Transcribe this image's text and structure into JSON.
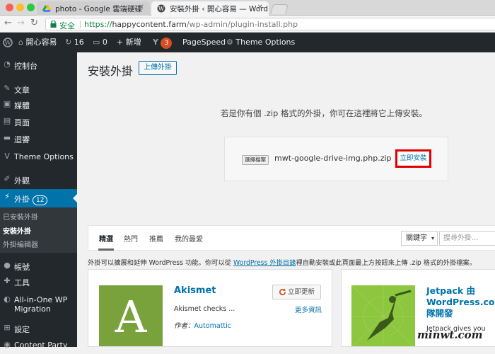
{
  "browser": {
    "tabs": [
      {
        "title": "photo - Google 雲端硬碟",
        "active": false
      },
      {
        "title": "安裝外掛 ‹ 開心容易 — WordPr",
        "active": true
      }
    ],
    "secure_label": "安全",
    "url_scheme": "https://",
    "url_host": "happycontent.farm",
    "url_path": "/wp-admin/plugin-install.php"
  },
  "adminbar": {
    "site_name": "開心容易",
    "updates_count": "16",
    "comments_count": "0",
    "new_label": "+ 新增",
    "yoast_count": "3",
    "pagespeed_label": "PageSpeed",
    "theme_options_label": "Theme Options"
  },
  "sidebar": {
    "items": [
      {
        "label": "控制台",
        "icon": "dashboard-icon"
      },
      {
        "label": "文章",
        "icon": "pin-icon"
      },
      {
        "label": "媒體",
        "icon": "media-icon"
      },
      {
        "label": "頁面",
        "icon": "page-icon"
      },
      {
        "label": "迴響",
        "icon": "comment-icon"
      },
      {
        "label": "Theme Options",
        "icon": "theme-options-icon"
      },
      {
        "label": "外觀",
        "icon": "appearance-icon"
      },
      {
        "label": "外掛",
        "icon": "plugin-icon",
        "count": "12"
      },
      {
        "label": "帳號",
        "icon": "user-icon"
      },
      {
        "label": "工具",
        "icon": "tools-icon"
      },
      {
        "label": "All-in-One WP Migration",
        "icon": "migration-icon"
      },
      {
        "label": "設定",
        "icon": "settings-icon"
      },
      {
        "label": "Content Party",
        "icon": "content-party-icon"
      }
    ],
    "submenu": [
      "已安裝外掛",
      "安裝外掛",
      "外掛編輯器"
    ]
  },
  "main": {
    "page_title": "安裝外掛",
    "upload_button": "上傳外掛",
    "upload_help": "若是你有個 .zip 格式的外掛，你可在這裡將它上傳安裝。",
    "choose_file": "選擇檔案",
    "file_name": "mwt-google-drive-img.php.zip",
    "install_now": "立即安裝",
    "filter_tabs": [
      "精選",
      "熱門",
      "推薦",
      "我的最愛"
    ],
    "keyword_select": "關鍵字",
    "search_placeholder": "搜尋外掛...",
    "intro_before": "外掛可以擴展和延伸 WordPress 功能。你可以從 ",
    "intro_link": "WordPress 外掛目錄",
    "intro_after": "裡自動安裝或此頁面最上方按鈕來上傳 .zip 格式的外掛檔案。"
  },
  "plugins": [
    {
      "name": "Akismet",
      "logo_letter": "A",
      "description": "Akismet checks ...",
      "author_label": "作者：",
      "author": "Automattic",
      "action": "立即更新",
      "more_details": "更多資訊"
    },
    {
      "name": "Jetpack 由 WordPress.com 隊開發",
      "description": "Jetpack gives you"
    }
  ],
  "watermark": "minwt.com",
  "colors": {
    "admin_dark": "#23282d",
    "wp_blue": "#0073aa",
    "highlight_red": "#e00000",
    "akismet_green": "#7aa23c",
    "jetpack_green": "#8dc63f"
  }
}
